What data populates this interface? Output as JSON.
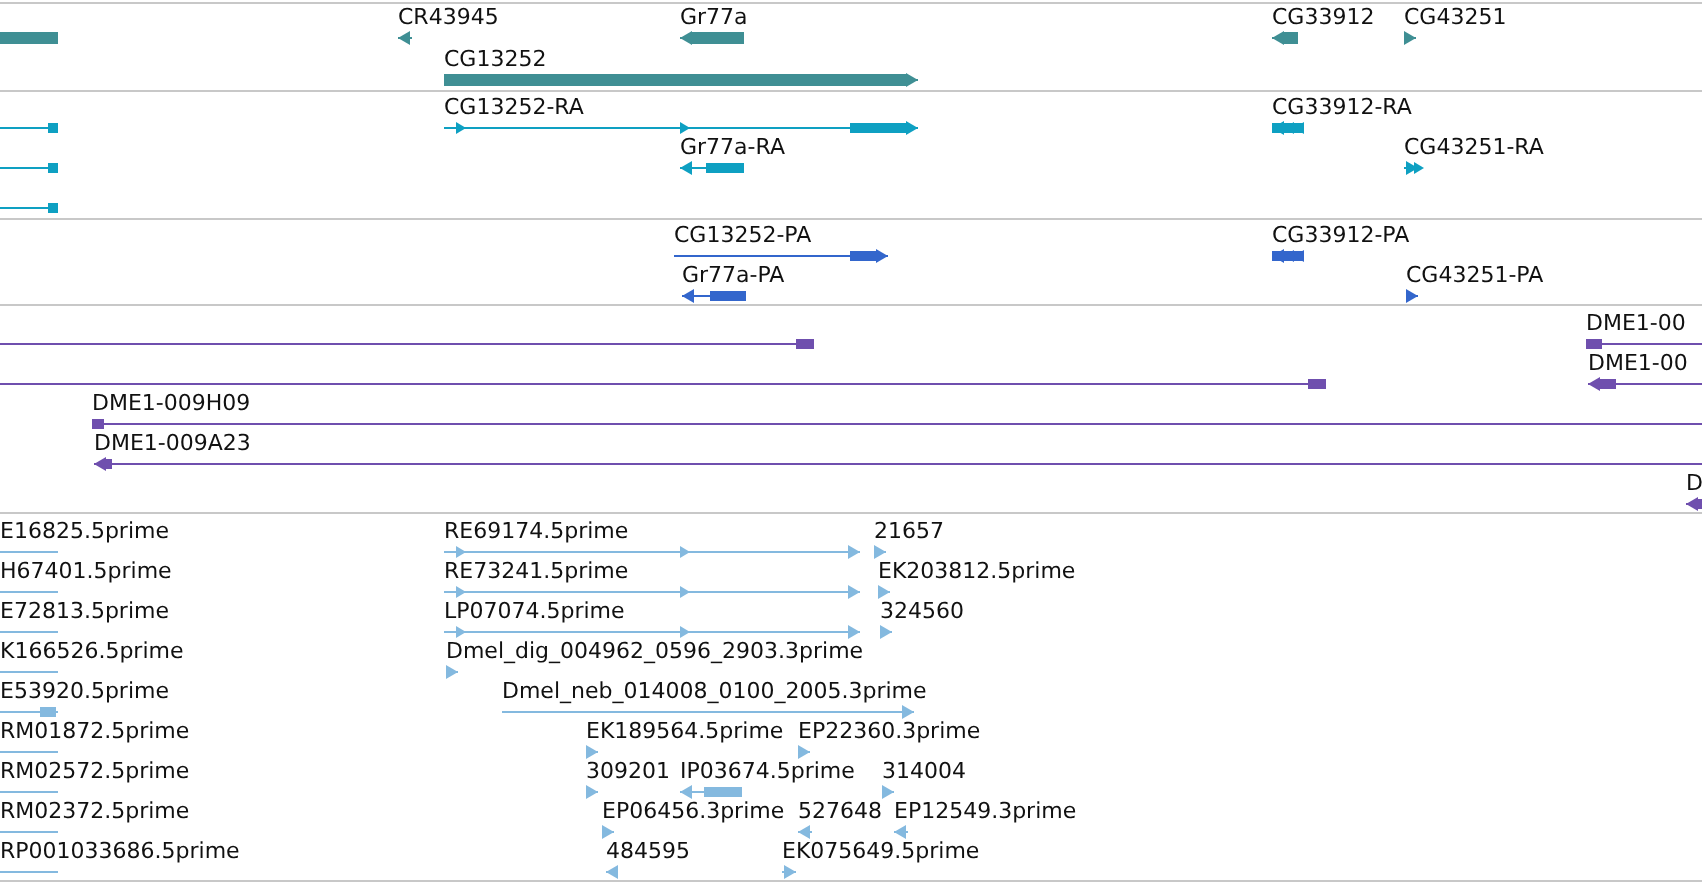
{
  "tracks": [
    {
      "kind": "gene",
      "features": [
        {
          "reverse": true
        },
        {
          "label": "CR43945",
          "reverse": true
        },
        {
          "label": "Gr77a",
          "reverse": true
        },
        {
          "label": "CG13252",
          "reverse": false
        },
        {
          "label": "CG33912",
          "reverse": true
        },
        {
          "label": "CG43251",
          "reverse": false
        }
      ]
    },
    {
      "kind": "transcript",
      "features": [
        {
          "reverse": true
        },
        {
          "reverse": true
        },
        {
          "reverse": true
        },
        {
          "label": "CG13252-RA",
          "reverse": false
        },
        {
          "label": "Gr77a-RA",
          "reverse": true
        },
        {
          "label": "CG33912-RA",
          "reverse": true
        },
        {
          "label": "CG43251-RA",
          "reverse": false
        }
      ]
    },
    {
      "kind": "protein",
      "features": [
        {
          "label": "CG13252-PA",
          "reverse": false
        },
        {
          "label": "Gr77a-PA",
          "reverse": true
        },
        {
          "label": "CG33912-PA",
          "reverse": true
        },
        {
          "label": "CG43251-PA",
          "reverse": false
        }
      ]
    },
    {
      "kind": "clone",
      "features": [
        {
          "reverse": true
        },
        {
          "reverse": true
        },
        {
          "label": "DME1-00",
          "reverse": false
        },
        {
          "label": "DME1-00",
          "reverse": true
        },
        {
          "label": "DME1-009H09",
          "reverse": false
        },
        {
          "label": "DME1-009A23",
          "reverse": true
        },
        {
          "label": "D",
          "reverse": true
        }
      ]
    },
    {
      "kind": "est",
      "features": [
        {
          "label": "E16825.5prime",
          "reverse": true
        },
        {
          "label": "H67401.5prime",
          "reverse": true
        },
        {
          "label": "E72813.5prime",
          "reverse": true
        },
        {
          "label": "K166526.5prime",
          "reverse": true
        },
        {
          "label": "E53920.5prime",
          "reverse": true
        },
        {
          "label": "RM01872.5prime",
          "reverse": true
        },
        {
          "label": "RM02572.5prime",
          "reverse": true
        },
        {
          "label": "RM02372.5prime",
          "reverse": true
        },
        {
          "label": "RP001033686.5prime",
          "reverse": true
        },
        {
          "label": "RE69174.5prime",
          "reverse": false
        },
        {
          "label": "21657",
          "reverse": false
        },
        {
          "label": "RE73241.5prime",
          "reverse": false
        },
        {
          "label": "EK203812.5prime",
          "reverse": false
        },
        {
          "label": "LP07074.5prime",
          "reverse": false
        },
        {
          "label": "324560",
          "reverse": false
        },
        {
          "label": "Dmel_dig_004962_0596_2903.3prime",
          "reverse": false
        },
        {
          "label": "Dmel_neb_014008_0100_2005.3prime",
          "reverse": false
        },
        {
          "label": "EK189564.5prime",
          "reverse": false
        },
        {
          "label": "EP22360.3prime",
          "reverse": false
        },
        {
          "label": "309201",
          "reverse": false
        },
        {
          "label": "IP03674.5prime",
          "reverse": true
        },
        {
          "label": "314004",
          "reverse": false
        },
        {
          "label": "EP06456.3prime",
          "reverse": false
        },
        {
          "label": "527648",
          "reverse": true
        },
        {
          "label": "EP12549.3prime",
          "reverse": true
        },
        {
          "label": "484595",
          "reverse": true
        },
        {
          "label": "EK075649.5prime",
          "reverse": false
        }
      ]
    }
  ]
}
